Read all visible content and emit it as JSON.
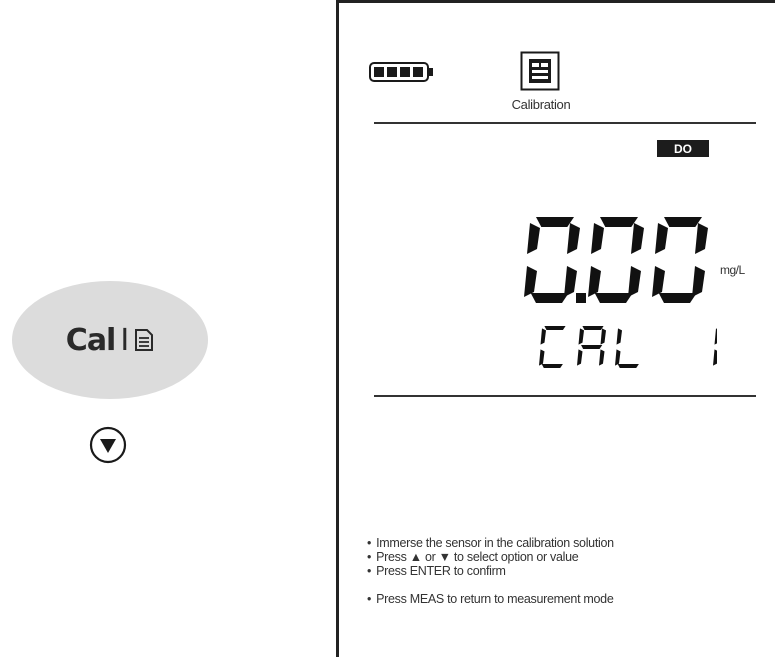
{
  "control_panel": {
    "cal_key": {
      "label": "Cal",
      "separator": "I",
      "icon": "document-icon"
    },
    "down_key": {
      "icon": "down-triangle-icon"
    }
  },
  "display": {
    "battery": {
      "icon": "battery-icon",
      "level_bars": 4,
      "max_bars": 4
    },
    "mode": {
      "icon": "calibration-icon",
      "label": "Calibration"
    },
    "parameter_badge": "DO",
    "reading": {
      "value": "0.00",
      "unit": "mg/L"
    },
    "status_text": "CAL 1",
    "instructions": [
      "Immerse the sensor in the calibration solution",
      "Press ▲ or ▼ to select option or value",
      "Press ENTER to confirm",
      "Press MEAS to return to measurement mode"
    ]
  },
  "colors": {
    "screen_background": "#ffffff",
    "segment": "#111111",
    "key_background": "#dcdcdc",
    "badge_background": "#1c1c1c"
  }
}
